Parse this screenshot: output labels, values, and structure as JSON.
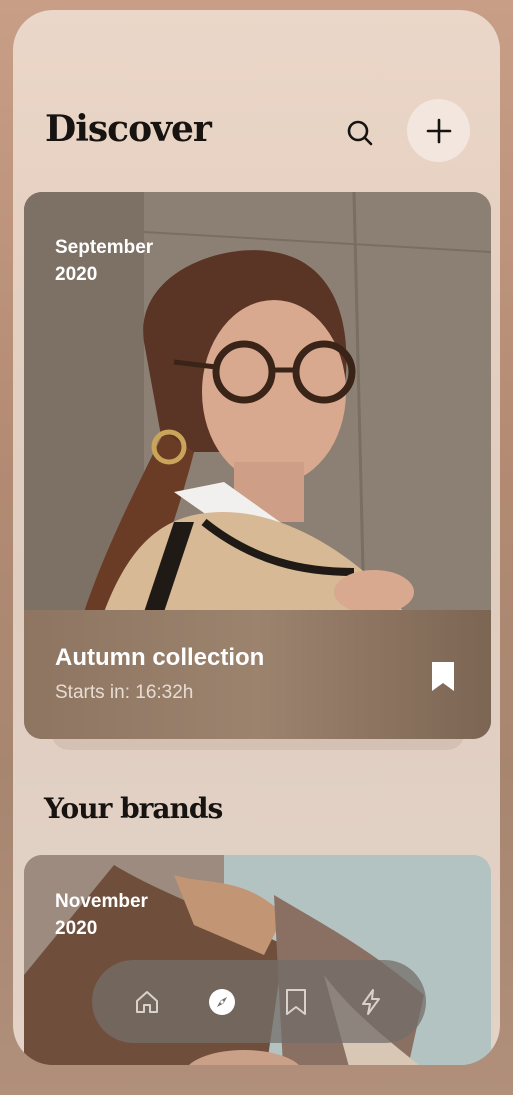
{
  "header": {
    "title": "Discover",
    "search_icon": "search-icon",
    "add_icon": "plus-icon"
  },
  "featured_card": {
    "date": "September\n2020",
    "name": "Autumn collection",
    "starts_in": "Starts in: 16:32h",
    "bookmark_icon": "bookmark-icon"
  },
  "section": {
    "title": "Your brands"
  },
  "brand_card": {
    "date": "November\n2020"
  },
  "nav": {
    "items": [
      {
        "icon": "home-icon",
        "active": false
      },
      {
        "icon": "compass-icon",
        "active": true
      },
      {
        "icon": "bookmark-icon",
        "active": false
      },
      {
        "icon": "lightning-icon",
        "active": false
      }
    ]
  },
  "colors": {
    "title": "#161311",
    "nav_bg": "#736e69",
    "card_footer": "#9c836e",
    "add_button_bg": "#f2e6de"
  }
}
